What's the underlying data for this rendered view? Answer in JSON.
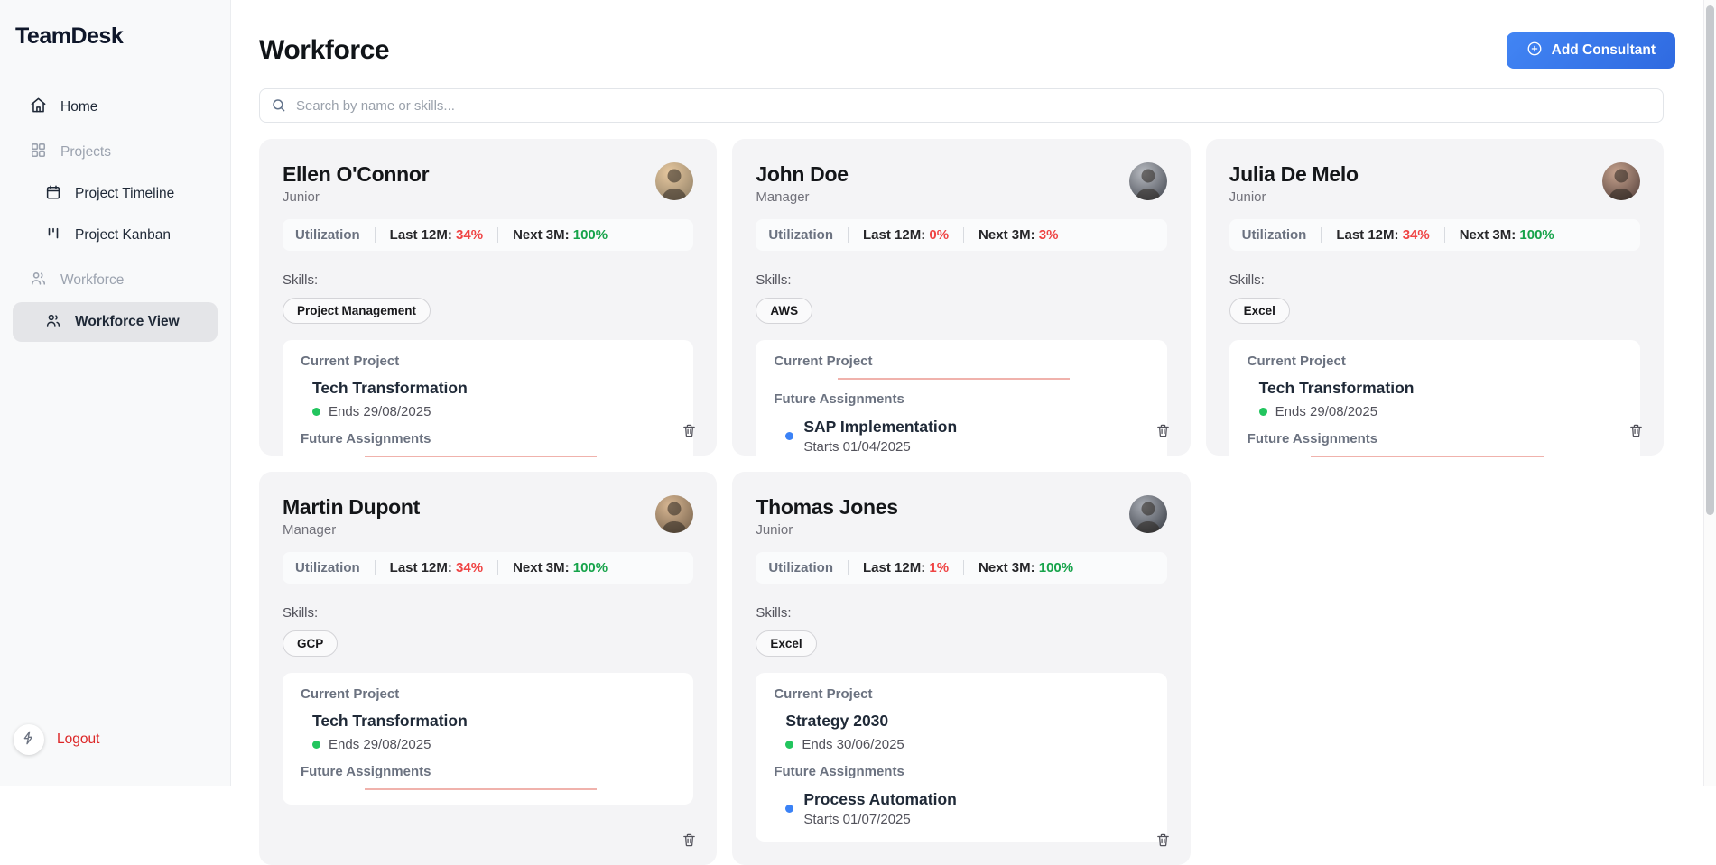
{
  "app": {
    "title": "TeamDesk"
  },
  "sidebar": {
    "items": [
      {
        "label": "Home",
        "icon": "home-icon"
      },
      {
        "label": "Projects",
        "icon": "grid-icon"
      },
      {
        "label": "Project Timeline",
        "icon": "calendar-icon"
      },
      {
        "label": "Project Kanban",
        "icon": "kanban-icon"
      },
      {
        "label": "Workforce",
        "icon": "users-icon"
      },
      {
        "label": "Workforce View",
        "icon": "users-icon"
      }
    ],
    "logout_label": "Logout"
  },
  "header": {
    "title": "Workforce",
    "add_button_label": "Add Consultant"
  },
  "search": {
    "placeholder": "Search by name or skills..."
  },
  "labels": {
    "utilization": "Utilization",
    "last_12m": "Last 12M:",
    "next_3m": "Next 3M:",
    "skills": "Skills:",
    "current_project": "Current Project",
    "future_assignments": "Future Assignments"
  },
  "colors": {
    "accent_blue": "#3b82f6",
    "negative_red": "#ef4444",
    "positive_green": "#16a34a",
    "logout_red": "#dc2626",
    "current_dot_green": "#22c55e",
    "future_dot_blue": "#3b82f6",
    "empty_underline": "#f0b2ac"
  },
  "consultants": [
    {
      "name": "Ellen O'Connor",
      "role": "Junior",
      "last_12m": "34%",
      "last_12m_color": "red",
      "next_3m": "100%",
      "next_3m_color": "green",
      "skills": [
        "Project Management"
      ],
      "current_project": {
        "name": "Tech Transformation",
        "date": "Ends 29/08/2025"
      },
      "future_assignment": null,
      "avatar_tones": [
        "#e8c9a0",
        "#8a7a62"
      ]
    },
    {
      "name": "John Doe",
      "role": "Manager",
      "last_12m": "0%",
      "last_12m_color": "red",
      "next_3m": "3%",
      "next_3m_color": "red",
      "skills": [
        "AWS"
      ],
      "current_project": null,
      "future_assignment": {
        "name": "SAP Implementation",
        "date": "Starts 01/04/2025"
      },
      "avatar_tones": [
        "#b9bcc2",
        "#3c4049"
      ]
    },
    {
      "name": "Julia De Melo",
      "role": "Junior",
      "last_12m": "34%",
      "last_12m_color": "red",
      "next_3m": "100%",
      "next_3m_color": "green",
      "skills": [
        "Excel"
      ],
      "current_project": {
        "name": "Tech Transformation",
        "date": "Ends 29/08/2025"
      },
      "future_assignment": null,
      "avatar_tones": [
        "#c7a38e",
        "#4d3a36"
      ]
    },
    {
      "name": "Martin Dupont",
      "role": "Manager",
      "last_12m": "34%",
      "last_12m_color": "red",
      "next_3m": "100%",
      "next_3m_color": "green",
      "skills": [
        "GCP"
      ],
      "current_project": {
        "name": "Tech Transformation",
        "date": "Ends 29/08/2025"
      },
      "future_assignment": null,
      "avatar_tones": [
        "#d9b894",
        "#6e5a45"
      ]
    },
    {
      "name": "Thomas Jones",
      "role": "Junior",
      "last_12m": "1%",
      "last_12m_color": "red",
      "next_3m": "100%",
      "next_3m_color": "green",
      "skills": [
        "Excel"
      ],
      "current_project": {
        "name": "Strategy 2030",
        "date": "Ends 30/06/2025"
      },
      "future_assignment": {
        "name": "Process Automation",
        "date": "Starts 01/07/2025"
      },
      "avatar_tones": [
        "#a9adb5",
        "#2f333b"
      ]
    }
  ]
}
